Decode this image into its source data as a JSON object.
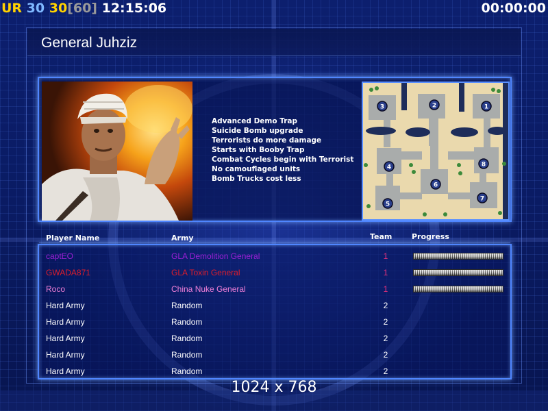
{
  "hud": {
    "left_segments": [
      {
        "text": "UR",
        "color": "#ffd200"
      },
      {
        "text": " 30",
        "color": "#7fb8ff"
      },
      {
        "text": " 30",
        "color": "#ffd200"
      },
      {
        "text": "[60]",
        "color": "#9a9a9a"
      },
      {
        "text": " 12:15:06",
        "color": "#ffffff"
      }
    ],
    "timer": "00:00:00"
  },
  "general": {
    "title": "General Juhziz",
    "features": [
      "Advanced Demo Trap",
      "Suicide Bomb upgrade",
      "Terrorists do more damage",
      "Starts with Booby Trap",
      "Combat Cycles begin with Terrorist",
      "No camouflaged units",
      "Bomb Trucks cost less"
    ]
  },
  "map": {
    "markers": [
      "1",
      "2",
      "3",
      "4",
      "5",
      "6",
      "7",
      "8"
    ]
  },
  "players": {
    "headers": {
      "name": "Player Name",
      "army": "Army",
      "team": "Team",
      "progress": "Progress"
    },
    "rows": [
      {
        "name": "captEO",
        "army": "GLA Demolition General",
        "team": "1",
        "color": "#9c1fd6",
        "team_color": "#e8307a",
        "progress": 1.0
      },
      {
        "name": "GWADA871",
        "army": "GLA Toxin General",
        "team": "1",
        "color": "#e01d2a",
        "team_color": "#e8307a",
        "progress": 1.0
      },
      {
        "name": "Roco",
        "army": "China Nuke General",
        "team": "1",
        "color": "#f07fd8",
        "team_color": "#e8307a",
        "progress": 1.0
      },
      {
        "name": "Hard Army",
        "army": "Random",
        "team": "2",
        "color": "#ffffff",
        "team_color": "#ffffff",
        "progress": null
      },
      {
        "name": "Hard Army",
        "army": "Random",
        "team": "2",
        "color": "#ffffff",
        "team_color": "#ffffff",
        "progress": null
      },
      {
        "name": "Hard Army",
        "army": "Random",
        "team": "2",
        "color": "#ffffff",
        "team_color": "#ffffff",
        "progress": null
      },
      {
        "name": "Hard Army",
        "army": "Random",
        "team": "2",
        "color": "#ffffff",
        "team_color": "#ffffff",
        "progress": null
      },
      {
        "name": "Hard Army",
        "army": "Random",
        "team": "2",
        "color": "#ffffff",
        "team_color": "#ffffff",
        "progress": null
      }
    ]
  },
  "resolution": "1024 x 768",
  "colors": {
    "panel_border": "#4f86ff",
    "background": "#0a1a5c"
  }
}
